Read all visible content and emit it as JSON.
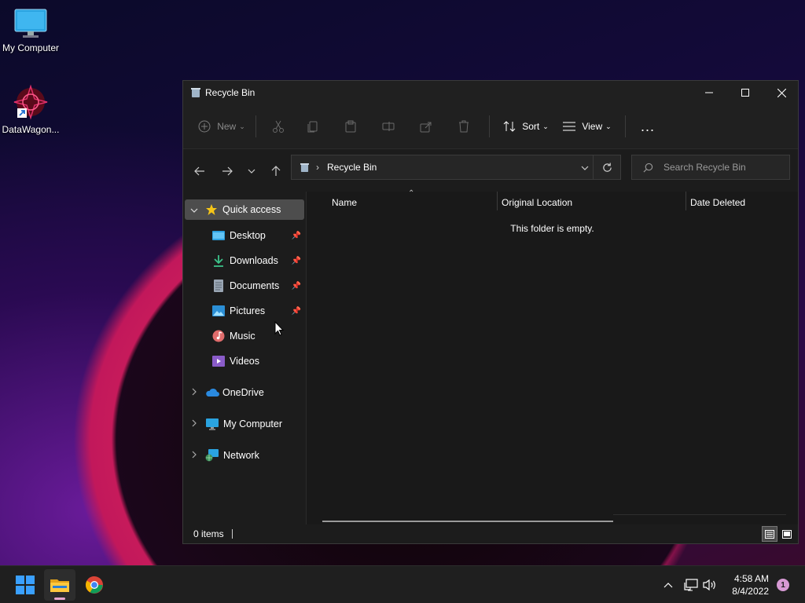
{
  "desktop": {
    "icons": [
      {
        "label": "My Computer"
      },
      {
        "label": "DataWagon..."
      }
    ]
  },
  "window": {
    "title": "Recycle Bin",
    "toolbar": {
      "new_label": "New",
      "sort_label": "Sort",
      "view_label": "View",
      "more_label": "..."
    },
    "address": {
      "crumb": "Recycle Bin"
    },
    "search": {
      "placeholder": "Search Recycle Bin"
    },
    "nav": {
      "quick_access": "Quick access",
      "items": [
        {
          "label": "Desktop",
          "pinned": true
        },
        {
          "label": "Downloads",
          "pinned": true
        },
        {
          "label": "Documents",
          "pinned": true
        },
        {
          "label": "Pictures",
          "pinned": true
        },
        {
          "label": "Music",
          "pinned": false
        },
        {
          "label": "Videos",
          "pinned": false
        }
      ],
      "roots": [
        {
          "label": "OneDrive"
        },
        {
          "label": "My Computer"
        },
        {
          "label": "Network"
        }
      ]
    },
    "columns": [
      "Name",
      "Original Location",
      "Date Deleted"
    ],
    "empty_message": "This folder is empty.",
    "status": {
      "items": "0 items"
    }
  },
  "taskbar": {
    "time": "4:58 AM",
    "date": "8/4/2022",
    "notification_count": "1"
  },
  "colors": {
    "accent": "#0078d4",
    "window_bg": "#1c1c1c",
    "taskbar_bg": "#1f1f1f"
  }
}
